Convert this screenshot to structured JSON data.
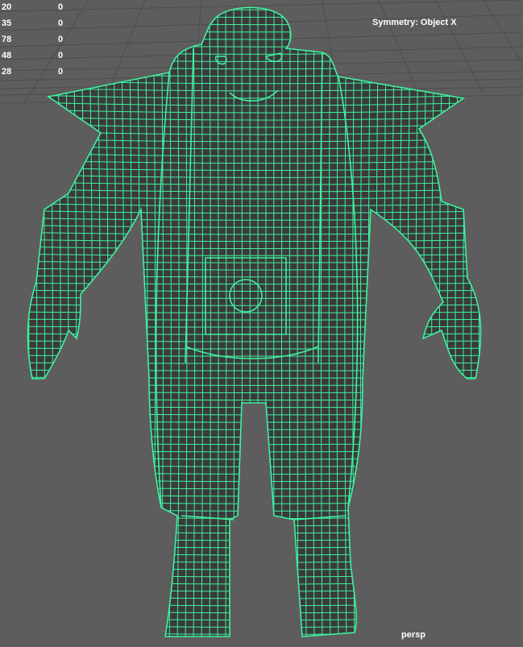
{
  "viewport": {
    "background_color": "#5d5d5d",
    "grid_color": "#4a4a4a",
    "wire_color": "#41f0a0",
    "mesh_fill_color": "#3a3a3a",
    "camera": "persp",
    "symmetry": "Symmetry: Object X"
  },
  "hud": {
    "rows": [
      {
        "a": "20",
        "b": "0"
      },
      {
        "a": "35",
        "b": "0"
      },
      {
        "a": "78",
        "b": "0"
      },
      {
        "a": "48",
        "b": "0"
      },
      {
        "a": "28",
        "b": "0"
      }
    ]
  }
}
